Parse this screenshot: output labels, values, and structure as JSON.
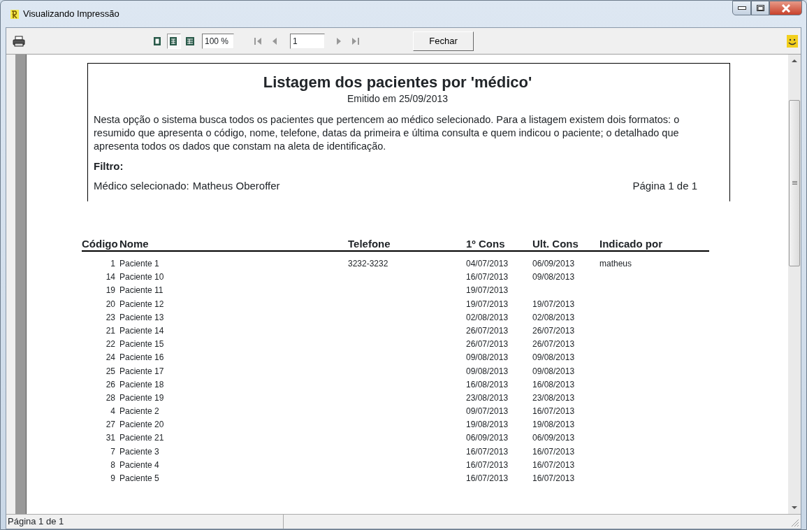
{
  "window": {
    "title": "Visualizando Impressão"
  },
  "toolbar": {
    "view_buttons": [
      {
        "kind": "single",
        "selected": false
      },
      {
        "kind": "double",
        "selected": true
      },
      {
        "kind": "multi",
        "selected": false
      }
    ],
    "zoom": "100 %",
    "page": "1",
    "close_button": "Fechar"
  },
  "report": {
    "title": "Listagem dos pacientes por 'médico'",
    "emitted_label": "Emitido em",
    "emitted_date": "25/09/2013",
    "description": "Nesta opção o sistema busca todos os pacientes que pertencem ao médico selecionado. Para a listagem existem dois formatos: o resumido que apresenta o código, nome, telefone, datas da primeira e última consulta e quem indicou o paciente; o detalhado que apresenta todos os dados que constam na aleta de identificação.",
    "filter_heading": "Filtro:",
    "filter_label": "Médico selecionado:",
    "filter_value": "Matheus Oberoffer",
    "page_info": "Página 1 de 1",
    "columns": [
      "Código",
      "Nome",
      "Telefone",
      "1º Cons",
      "Ult. Cons",
      "Indicado por"
    ],
    "rows": [
      [
        "1",
        "Paciente 1",
        "3232-3232",
        "04/07/2013",
        "06/09/2013",
        "matheus"
      ],
      [
        "14",
        "Paciente 10",
        "",
        "16/07/2013",
        "09/08/2013",
        ""
      ],
      [
        "19",
        "Paciente 11",
        "",
        "19/07/2013",
        "",
        ""
      ],
      [
        "20",
        "Paciente 12",
        "",
        "19/07/2013",
        "19/07/2013",
        ""
      ],
      [
        "23",
        "Paciente 13",
        "",
        "02/08/2013",
        "02/08/2013",
        ""
      ],
      [
        "21",
        "Paciente 14",
        "",
        "26/07/2013",
        "26/07/2013",
        ""
      ],
      [
        "22",
        "Paciente 15",
        "",
        "26/07/2013",
        "26/07/2013",
        ""
      ],
      [
        "24",
        "Paciente 16",
        "",
        "09/08/2013",
        "09/08/2013",
        ""
      ],
      [
        "25",
        "Paciente 17",
        "",
        "09/08/2013",
        "09/08/2013",
        ""
      ],
      [
        "26",
        "Paciente 18",
        "",
        "16/08/2013",
        "16/08/2013",
        ""
      ],
      [
        "28",
        "Paciente 19",
        "",
        "23/08/2013",
        "23/08/2013",
        ""
      ],
      [
        "4",
        "Paciente 2",
        "",
        "09/07/2013",
        "16/07/2013",
        ""
      ],
      [
        "27",
        "Paciente 20",
        "",
        "19/08/2013",
        "19/08/2013",
        ""
      ],
      [
        "31",
        "Paciente 21",
        "",
        "06/09/2013",
        "06/09/2013",
        ""
      ],
      [
        "7",
        "Paciente 3",
        "",
        "16/07/2013",
        "16/07/2013",
        ""
      ],
      [
        "8",
        "Paciente 4",
        "",
        "16/07/2013",
        "16/07/2013",
        ""
      ],
      [
        "9",
        "Paciente 5",
        "",
        "16/07/2013",
        "16/07/2013",
        ""
      ]
    ]
  },
  "status_bar": {
    "text": "Página 1 de 1"
  }
}
